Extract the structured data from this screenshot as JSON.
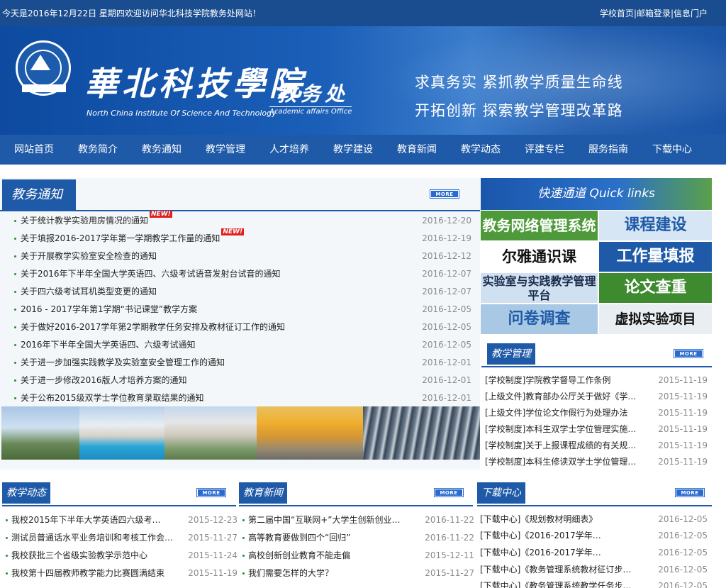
{
  "topbar": {
    "date_text": "今天是2016年12月22日 星期四欢迎访问华北科技学院教务处网站！",
    "links": [
      "学校首页",
      "邮箱登录",
      "信息门户"
    ],
    "separator": "|"
  },
  "banner": {
    "school_name": "華北科技學院",
    "school_name_en": "North China Institute Of Science And Technology",
    "office_name": "教务处",
    "office_name_en": "Academic affairs Office",
    "slogan_line1": "求真务实  紧抓教学质量生命线",
    "slogan_line2": "开拓创新  探索教学管理改革路"
  },
  "nav": [
    "网站首页",
    "教务简介",
    "教务通知",
    "教学管理",
    "人才培养",
    "教学建设",
    "教育新闻",
    "教学动态",
    "评建专栏",
    "服务指南",
    "下载中心"
  ],
  "more_label": "MORE",
  "notice": {
    "title": "教务通知",
    "new_label": "NEW!",
    "items": [
      {
        "text": "关于统计教学实验用房情况的通知",
        "date": "2016-12-20",
        "is_new": true
      },
      {
        "text": "关于填报2016-2017学年第一学期教学工作量的通知",
        "date": "2016-12-19",
        "is_new": true
      },
      {
        "text": "关于开展教学实验室安全检查的通知",
        "date": "2016-12-12",
        "is_new": false
      },
      {
        "text": "关于2016年下半年全国大学英语四、六级考试语音发射台试音的通知",
        "date": "2016-12-07",
        "is_new": false
      },
      {
        "text": "关于四六级考试耳机类型变更的通知",
        "date": "2016-12-07",
        "is_new": false
      },
      {
        "text": "2016 - 2017学年第1学期“书记课堂”教学方案",
        "date": "2016-12-05",
        "is_new": false
      },
      {
        "text": "关于做好2016-2017学年第2学期教学任务安排及教材征订工作的通知",
        "date": "2016-12-05",
        "is_new": false
      },
      {
        "text": "2016年下半年全国大学英语四、六级考试通知",
        "date": "2016-12-05",
        "is_new": false
      },
      {
        "text": "关于进一步加强实践教学及实验室安全管理工作的通知",
        "date": "2016-12-01",
        "is_new": false
      },
      {
        "text": "关于进一步修改2016版人才培养方案的通知",
        "date": "2016-12-01",
        "is_new": false
      },
      {
        "text": "关于公布2015级双学士学位教育录取结果的通知",
        "date": "2016-12-01",
        "is_new": false
      }
    ]
  },
  "quick_links": {
    "title": "快速通道 Quick links",
    "tiles": [
      "教务网络管理系统",
      "课程建设",
      "尔雅通识课",
      "工作量填报",
      "实验室与实践教学管理平台",
      "论文查重",
      "问卷调查",
      "虚拟实验项目"
    ]
  },
  "teaching_mgmt": {
    "title": "教学管理",
    "items": [
      {
        "text": "[学校制度]学院教学督导工作条例",
        "date": "2015-11-19"
      },
      {
        "text": "[上级文件]教育部办公厅关于做好《学…",
        "date": "2015-11-19"
      },
      {
        "text": "[上级文件]学位论文作假行为处理办法",
        "date": "2015-11-19"
      },
      {
        "text": "[学校制度]本科生双学士学位管理实施…",
        "date": "2015-11-19"
      },
      {
        "text": "[学校制度]关于上报课程成绩的有关规…",
        "date": "2015-11-19"
      },
      {
        "text": "[学校制度]本科生修读双学士学位管理…",
        "date": "2015-11-19"
      }
    ]
  },
  "teaching_news": {
    "title": "教学动态",
    "items": [
      {
        "text": "我校2015年下半年大学英语四六级考…",
        "date": "2015-12-23"
      },
      {
        "text": "测试员普通话水平业务培训和考核工作会…",
        "date": "2015-11-27"
      },
      {
        "text": "我校获批三个省级实验教学示范中心",
        "date": "2015-11-24"
      },
      {
        "text": "我校第十四届教师教学能力比赛圆满结束",
        "date": "2015-11-19"
      }
    ]
  },
  "edu_news": {
    "title": "教育新闻",
    "items": [
      {
        "text": "第二届中国“互联网+”大学生创新创业…",
        "date": "2016-11-22"
      },
      {
        "text": "高等教育要做到四个“回归”",
        "date": "2016-11-22"
      },
      {
        "text": "高校创新创业教育不能走偏",
        "date": "2015-12-11"
      },
      {
        "text": "我们需要怎样的大学？",
        "date": "2015-11-27"
      }
    ]
  },
  "downloads": {
    "title": "下载中心",
    "items": [
      {
        "text": "[下载中心]《规划教材明细表》",
        "date": "2016-12-05"
      },
      {
        "text": "[下载中心]《2016-2017学年…",
        "date": "2016-12-05"
      },
      {
        "text": "[下载中心]《2016-2017学年…",
        "date": "2016-12-05"
      },
      {
        "text": "[下载中心]《教务管理系统教材征订步…",
        "date": "2016-12-05"
      },
      {
        "text": "[下载中心]《教务管理系统教学任务步…",
        "date": "2016-12-05"
      }
    ]
  }
}
